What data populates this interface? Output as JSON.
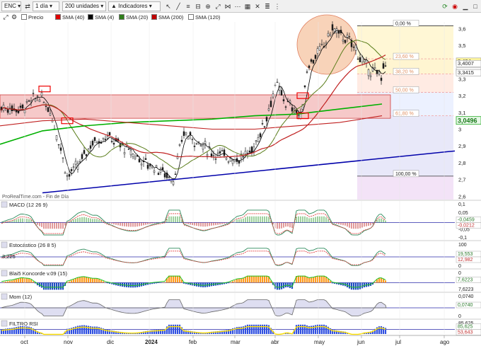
{
  "toolbar": {
    "symbol": "ENC",
    "timeframe": "1 día",
    "units": "200 unidades",
    "indicators_label": "Indicadores"
  },
  "legend": [
    {
      "label": "Precio",
      "color": "#ffffff"
    },
    {
      "label": "SMA (40)",
      "color": "#ff0000"
    },
    {
      "label": "SMA (4)",
      "color": "#000000"
    },
    {
      "label": "SMA (20)",
      "color": "#2e7d1a"
    },
    {
      "label": "SMA (200)",
      "color": "#c00000"
    },
    {
      "label": "SMA (120)",
      "color": "#ffffff"
    }
  ],
  "watermark": "ProRealTime.com - Fin de Día",
  "colors": {
    "price_candles": "#1a1a1a",
    "sma4": "#000000",
    "sma20": "#5a7d1a",
    "sma40": "#2a7a2a",
    "sma120": "#00b000",
    "sma200": "#c02020",
    "trendline": "#0000aa",
    "resistance_zone": "#f6c9c9",
    "fib_ret_1": "#fff6d0",
    "fib_ret_2": "#fff4cc",
    "fib_ret_3": "#ffe9e0",
    "fib_ret_4": "#eaf0ff",
    "fib_ret_5": "#e6e6f8",
    "fib_ret_6": "#f2e0f6"
  },
  "chart_data": [
    {
      "type": "line",
      "title": "Precio",
      "y_ticks": [
        "3,6",
        "3,5",
        "3,4",
        "3,3",
        "3,2",
        "3,1",
        "3",
        "2,9",
        "2,8",
        "2,7",
        "2,6"
      ],
      "ylim": [
        2.58,
        3.64
      ],
      "last_price": "3,0496",
      "price_labels": [
        "3,404",
        "3,4007",
        "3,3428",
        "3,3415"
      ],
      "fib_levels": [
        {
          "label": "0,00 %",
          "value": 3.617
        },
        {
          "label": "23,60 %",
          "value": 3.42
        },
        {
          "label": "38,20 %",
          "value": 3.33
        },
        {
          "label": "50,00 %",
          "value": 3.22
        },
        {
          "label": "61,80 %",
          "value": 3.08
        },
        {
          "label": "100,00 %",
          "value": 2.72
        }
      ],
      "resistance_zone": [
        3.065,
        3.205
      ],
      "trendline": {
        "start": [
          "oct",
          2.62
        ],
        "end": [
          "jul",
          2.87
        ]
      },
      "series": [
        {
          "name": "SMA (120)",
          "points": [
            [
              0,
              2.91
            ],
            [
              60,
              2.99
            ],
            [
              120,
              3.02
            ],
            [
              180,
              3.04
            ],
            [
              240,
              3.05
            ],
            [
              300,
              3.06
            ],
            [
              360,
              3.08
            ],
            [
              420,
              3.09
            ],
            [
              480,
              3.12
            ],
            [
              540,
              3.15
            ]
          ]
        },
        {
          "name": "SMA (200)",
          "points": [
            [
              0,
              3.02
            ],
            [
              60,
              3.05
            ],
            [
              120,
              3.06
            ],
            [
              180,
              3.04
            ],
            [
              240,
              3.02
            ],
            [
              300,
              3.0
            ],
            [
              360,
              3.0
            ],
            [
              420,
              3.02
            ],
            [
              480,
              3.04
            ],
            [
              540,
              3.08
            ]
          ]
        }
      ]
    },
    {
      "type": "line",
      "title": "MACD (12 26 9)",
      "y_ticks": [
        "0,1",
        "0,05",
        "0",
        "-0,05",
        "-0,1"
      ],
      "value_labels": [
        "-0,0459",
        "-0,0212"
      ]
    },
    {
      "type": "line",
      "title": "Estocástico (26 8 5)",
      "y_ticks": [
        "100",
        "50",
        "0"
      ],
      "value_labels": [
        "19,553",
        "12,982"
      ],
      "extra_label": "3,225"
    },
    {
      "type": "area",
      "title": "Blai5 Koncorde v.09 (15)",
      "y_ticks": [
        "0",
        "7,6223"
      ],
      "value_labels": [
        "7,6223"
      ]
    },
    {
      "type": "line",
      "title": "Mom (12)",
      "y_ticks": [
        "0,0740",
        "0"
      ],
      "value_labels": [
        "0,0740"
      ]
    },
    {
      "type": "line",
      "title": "FILTRO RSI",
      "y_ticks": [
        "85,625",
        "53,643"
      ],
      "value_labels": [
        "85,625",
        "53,643"
      ]
    }
  ],
  "x_ticks": [
    "oct",
    "nov",
    "dic",
    "2024",
    "feb",
    "mar",
    "abr",
    "may",
    "jun",
    "jul",
    "ago"
  ]
}
